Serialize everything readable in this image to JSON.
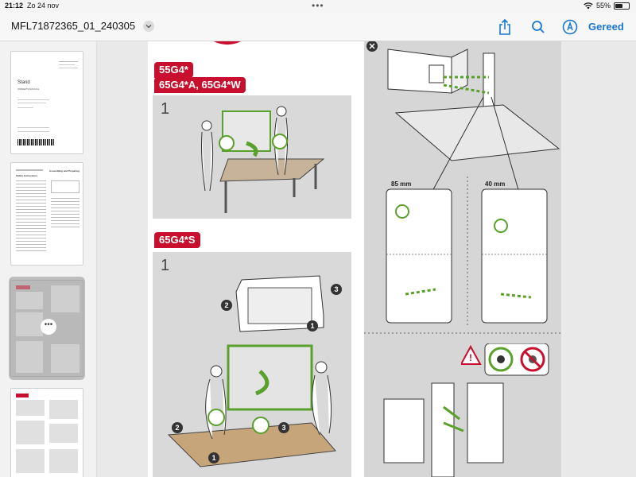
{
  "status": {
    "time": "21:12",
    "date": "Zo 24 nov",
    "battery": "55%",
    "battery_level": 0.55
  },
  "toolbar": {
    "title": "MFL71872365_01_240305",
    "done_label": "Gereed"
  },
  "icons": [
    "chevron-down-icon",
    "share-icon",
    "search-icon",
    "markup-icon",
    "wifi-icon",
    "battery-icon",
    "more-icon"
  ],
  "thumbnails": [
    {
      "title": "Stand",
      "subtitle": "OWNER'S MANUAL"
    },
    {
      "left_heading": "Safety Instructions",
      "right_heading": "Assembling and Preparing"
    },
    {
      "selected": true
    },
    {}
  ],
  "page": {
    "models_top_1": "55G4*",
    "models_top_2": "65G4*A, 65G4*W",
    "models_bottom": "65G4*S",
    "step_1": "1",
    "step_2": "1",
    "mm_left": "85 mm",
    "mm_right": "40 mm",
    "callouts": [
      "2",
      "3",
      "1",
      "2",
      "3",
      "1"
    ]
  },
  "colors": {
    "accent": "#1976d2",
    "brand_red": "#c8102e",
    "green": "#5aa02c"
  }
}
